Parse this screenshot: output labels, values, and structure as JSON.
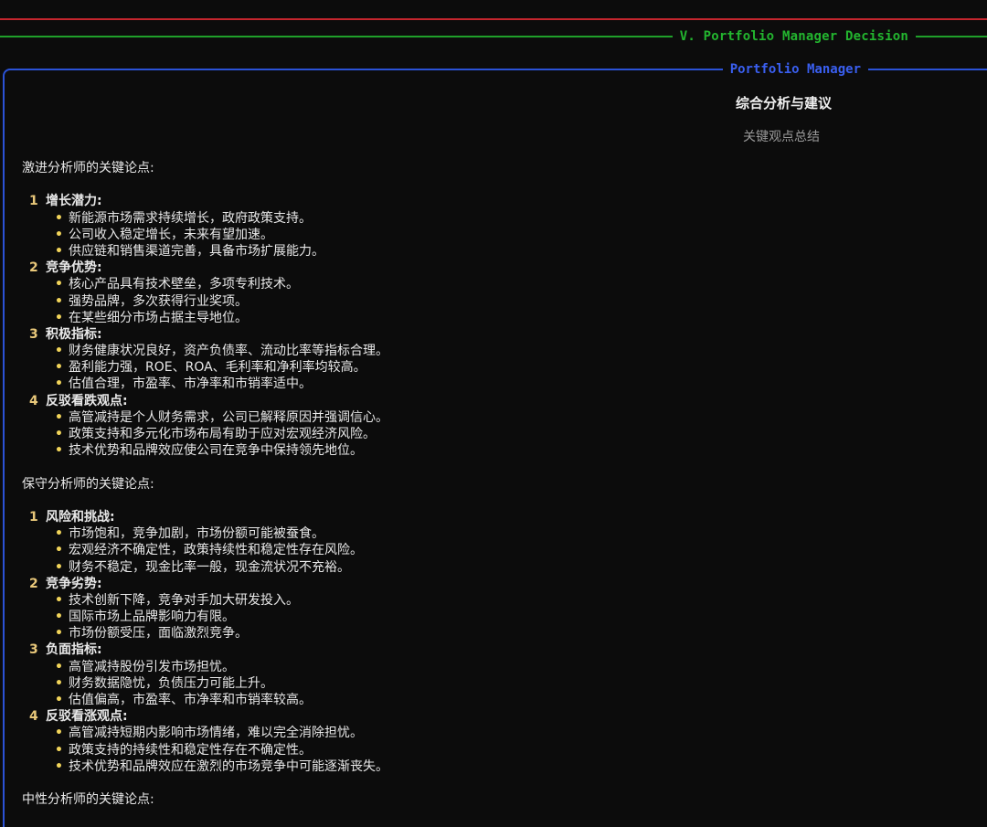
{
  "section": {
    "title": "V. Portfolio Manager Decision"
  },
  "panel": {
    "title": "Portfolio Manager",
    "heading": "综合分析与建议",
    "subheading": "关键观点总结"
  },
  "aggressive": {
    "title": "激进分析师的关键论点:",
    "items": [
      {
        "num": "1",
        "label": "增长潜力:",
        "bullets": [
          "新能源市场需求持续增长，政府政策支持。",
          "公司收入稳定增长，未来有望加速。",
          "供应链和销售渠道完善，具备市场扩展能力。"
        ]
      },
      {
        "num": "2",
        "label": "竞争优势:",
        "bullets": [
          "核心产品具有技术壁垒，多项专利技术。",
          "强势品牌，多次获得行业奖项。",
          "在某些细分市场占据主导地位。"
        ]
      },
      {
        "num": "3",
        "label": "积极指标:",
        "bullets": [
          "财务健康状况良好，资产负债率、流动比率等指标合理。",
          "盈利能力强，ROE、ROA、毛利率和净利率均较高。",
          "估值合理，市盈率、市净率和市销率适中。"
        ]
      },
      {
        "num": "4",
        "label": "反驳看跌观点:",
        "bullets": [
          "高管减持是个人财务需求，公司已解释原因并强调信心。",
          "政策支持和多元化市场布局有助于应对宏观经济风险。",
          "技术优势和品牌效应使公司在竞争中保持领先地位。"
        ]
      }
    ]
  },
  "conservative": {
    "title": "保守分析师的关键论点:",
    "items": [
      {
        "num": "1",
        "label": "风险和挑战:",
        "bullets": [
          "市场饱和，竞争加剧，市场份额可能被蚕食。",
          "宏观经济不确定性，政策持续性和稳定性存在风险。",
          "财务不稳定，现金比率一般，现金流状况不充裕。"
        ]
      },
      {
        "num": "2",
        "label": "竞争劣势:",
        "bullets": [
          "技术创新下降，竞争对手加大研发投入。",
          "国际市场上品牌影响力有限。",
          "市场份额受压，面临激烈竞争。"
        ]
      },
      {
        "num": "3",
        "label": "负面指标:",
        "bullets": [
          "高管减持股份引发市场担忧。",
          "财务数据隐忧，负债压力可能上升。",
          "估值偏高，市盈率、市净率和市销率较高。"
        ]
      },
      {
        "num": "4",
        "label": "反驳看涨观点:",
        "bullets": [
          "高管减持短期内影响市场情绪，难以完全消除担忧。",
          "政策支持的持续性和稳定性存在不确定性。",
          "技术优势和品牌效应在激烈的市场竞争中可能逐渐丧失。"
        ]
      }
    ]
  },
  "neutral": {
    "title": "中性分析师的关键论点:"
  },
  "colors": {
    "rule_red": "#c4262e",
    "rule_green": "#1fa02a",
    "panel_blue": "#2b52d6",
    "number_yellow": "#e9c87a",
    "bullet_yellow": "#f2d55a"
  },
  "icons": {
    "bullet": "•"
  }
}
